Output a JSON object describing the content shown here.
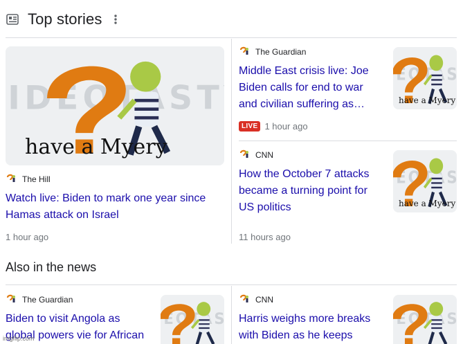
{
  "top_stories": {
    "title": "Top stories",
    "icons": {
      "section": "newspaper-icon",
      "menu": "more-vert-icon"
    },
    "featured": {
      "source": "The Hill",
      "headline": "Watch live: Biden to mark one year since Hamas attack on Israel",
      "time": "1 hour ago",
      "thumbnail_caption": "have a Myery",
      "thumbnail_watermark": "VIDEOTASTY"
    },
    "side": [
      {
        "source": "The Guardian",
        "headline": "Middle East crisis live: Joe Biden calls for end to war and civilian suffering as…",
        "live_badge": "LIVE",
        "time": "1 hour ago",
        "thumbnail_caption": "have a Myery",
        "thumbnail_watermark": "VIDEOTASTY"
      },
      {
        "source": "CNN",
        "headline": "How the October 7 attacks became a turning point for US politics",
        "time": "11 hours ago",
        "thumbnail_caption": "have a Myery",
        "thumbnail_watermark": "VIDEOTASTY"
      }
    ]
  },
  "also_in_news": {
    "title": "Also in the news",
    "items": [
      {
        "source": "The Guardian",
        "headline": "Biden to visit Angola as global powers vie for African",
        "thumbnail_watermark": "VIDEOTASTY"
      },
      {
        "source": "CNN",
        "headline": "Harris weighs more breaks with Biden as he keeps",
        "thumbnail_watermark": "VIDEOTASTY"
      }
    ]
  },
  "watermark": "imgflip.com",
  "colors": {
    "headline_link": "#1a0dab",
    "live_badge": "#d93025",
    "divider": "#dadce0",
    "meta_text": "#70757a"
  }
}
